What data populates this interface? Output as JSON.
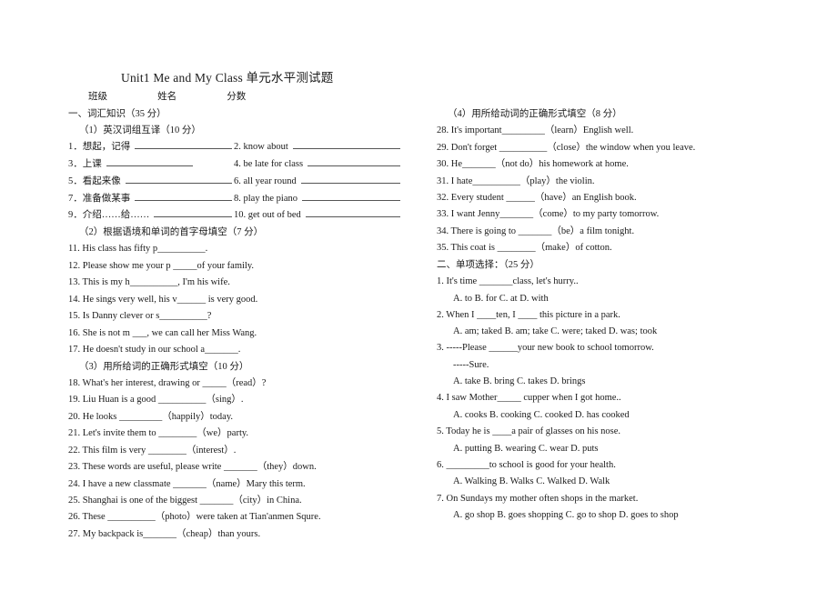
{
  "document": {
    "title": "Unit1 Me and My Class 单元水平测试题",
    "info_line": {
      "class_label": "班级",
      "name_label": "姓名",
      "score_label": "分数"
    }
  },
  "left_column": {
    "section1_head": "一、词汇知识（35 分）",
    "part1_head": "（1）英汉词组互译（10 分）",
    "part1_pairs": [
      {
        "left": "1．想起，记得",
        "right": "2. know about"
      },
      {
        "left": "3．上课",
        "right": "4. be late for class"
      },
      {
        "left": "5．看起来像",
        "right": "6. all year round"
      },
      {
        "left": "7．准备做某事",
        "right": "8. play the piano"
      },
      {
        "left": "9．介绍……给……",
        "right": "10. get out of bed"
      }
    ],
    "part2_head": "（2）根据语境和单词的首字母填空（7 分）",
    "part2_items": [
      "11. His class has fifty p__________.",
      "12. Please show me your p _____of your family.",
      "13. This is my h__________, I'm his wife.",
      "14. He sings very well, his v______ is very good.",
      "15. Is Danny clever or s__________?",
      "16. She is not m ___, we can call her Miss Wang.",
      "17. He doesn't study in our school a_______."
    ],
    "part3_head": "（3）用所给词的正确形式填空（10 分）",
    "part3_items": [
      "18. What's her interest, drawing or _____（read）?",
      "19. Liu Huan is a good __________（sing）.",
      "20. He looks _________（happily）today.",
      "21. Let's invite them to ________（we）party.",
      "22. This film is very ________（interest）.",
      "23. These words are useful, please write _______（they）down.",
      "24. I have a new classmate _______（name）Mary this term.",
      "25. Shanghai is one of the biggest _______（city）in China.",
      "26. These __________（photo）were taken at Tian'anmen Squre.",
      "27. My backpack is_______（cheap）than yours."
    ]
  },
  "right_column": {
    "part4_head": "（4）用所给动词的正确形式填空（8 分）",
    "part4_items": [
      "28. It's important_________（learn）English well.",
      "29. Don't forget __________（close）the window when you leave.",
      "30. He_______（not do）his homework at home.",
      "31. I hate__________（play）the violin.",
      "32. Every student ______（have）an English book.",
      "33. I want Jenny_______（come）to my party tomorrow.",
      "34. There is going to _______（be）a film tonight.",
      "35. This coat is ________（make）of cotton."
    ],
    "section2_head": "二、单项选择：（25 分）",
    "section2_items": [
      {
        "stem": "1. It's time _______class, let's hurry..",
        "options": "A. to    B. for   C. at    D. with"
      },
      {
        "stem": "2. When I ____ten, I ____ this picture in a park.",
        "options": "A. am; taked   B. am; take  C. were; taked   D. was; took"
      },
      {
        "stem": "3. -----Please ______your new book to school tomorrow.",
        "continuation": "-----Sure.",
        "options": "A. take    B. bring   C. takes    D. brings"
      },
      {
        "stem": "4. I saw Mother_____ cupper when I got home..",
        "options": "A. cooks   B. cooking  C. cooked   D. has cooked"
      },
      {
        "stem": "5. Today he is ____a pair of glasses on his nose.",
        "options": "A. putting   B. wearing  C. wear   D. puts"
      },
      {
        "stem": "6. _________to school is good for your health.",
        "options": "A. Walking   B. Walks  C. Walked   D. Walk"
      },
      {
        "stem": "7. On Sundays my mother often shops in the market.",
        "options": "A. go shop   B. goes shopping  C. go to shop   D. goes to shop"
      }
    ]
  }
}
